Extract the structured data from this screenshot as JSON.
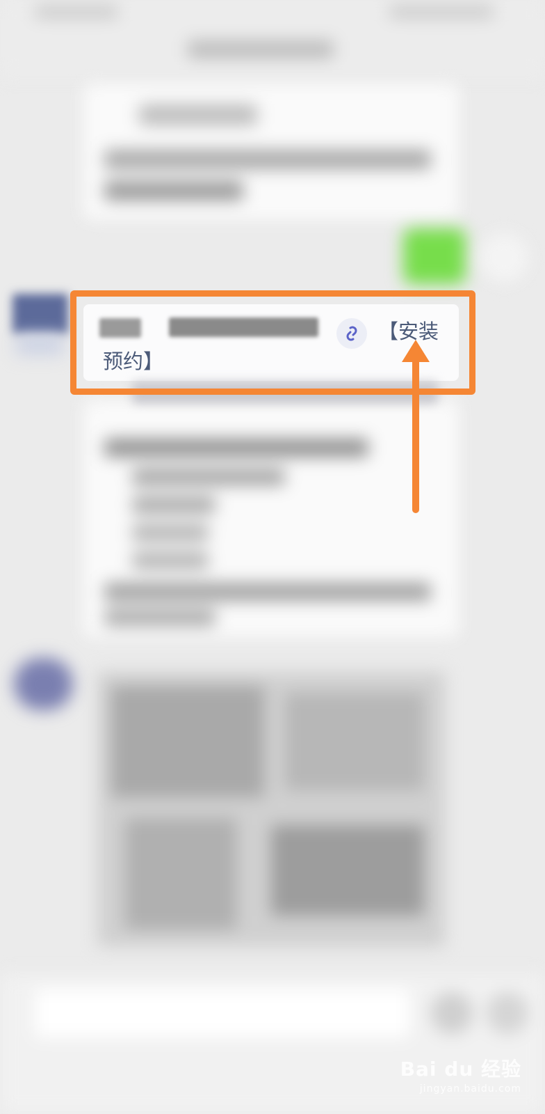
{
  "message_card": {
    "line1_label": "【安装",
    "line2_label": "预约】",
    "link_icon": "mini-program-link-icon"
  },
  "annotation": {
    "color": "#f58634"
  },
  "watermark": {
    "brand": "Bai du 经验",
    "url": "jingyan.baidu.com"
  }
}
